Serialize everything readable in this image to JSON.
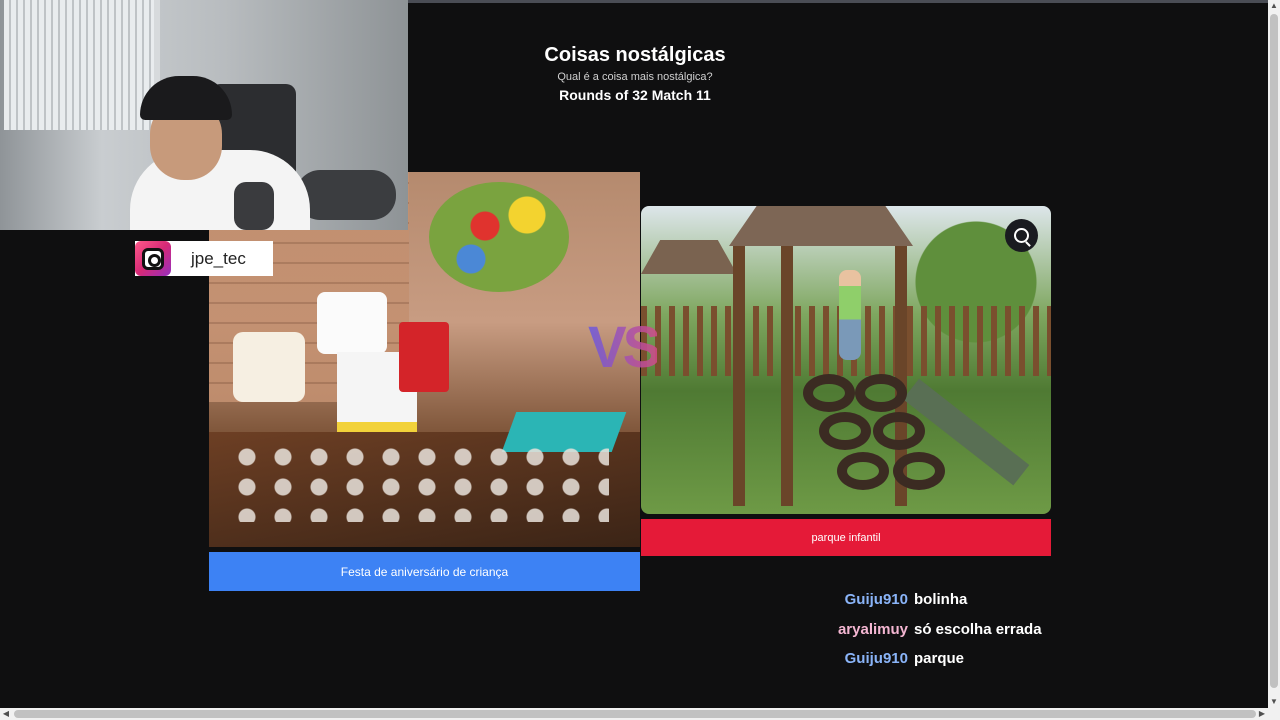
{
  "header": {
    "title": "Coisas nostálgicas",
    "subtitle": "Qual é a coisa mais nostálgica?",
    "round": "Rounds of 32 Match 11"
  },
  "streamer": {
    "instagram_handle": "jpe_tec"
  },
  "vs_label": "VS",
  "choices": {
    "left_label": "Festa de aniversário de criança",
    "right_label": "parque infantil"
  },
  "chat": [
    {
      "user": "Guiju910",
      "message": "bolinha",
      "color": "#8ab4f8"
    },
    {
      "user": "aryalimuy",
      "message": "só escolha errada",
      "color": "#f4b6d2"
    },
    {
      "user": "Guiju910",
      "message": "parque",
      "color": "#8ab4f8"
    }
  ],
  "colors": {
    "left_button": "#3d82f4",
    "right_button": "#e51a38",
    "background": "#0f0f10"
  },
  "icons": {
    "zoom": "zoom-in-icon",
    "instagram": "instagram-icon"
  }
}
